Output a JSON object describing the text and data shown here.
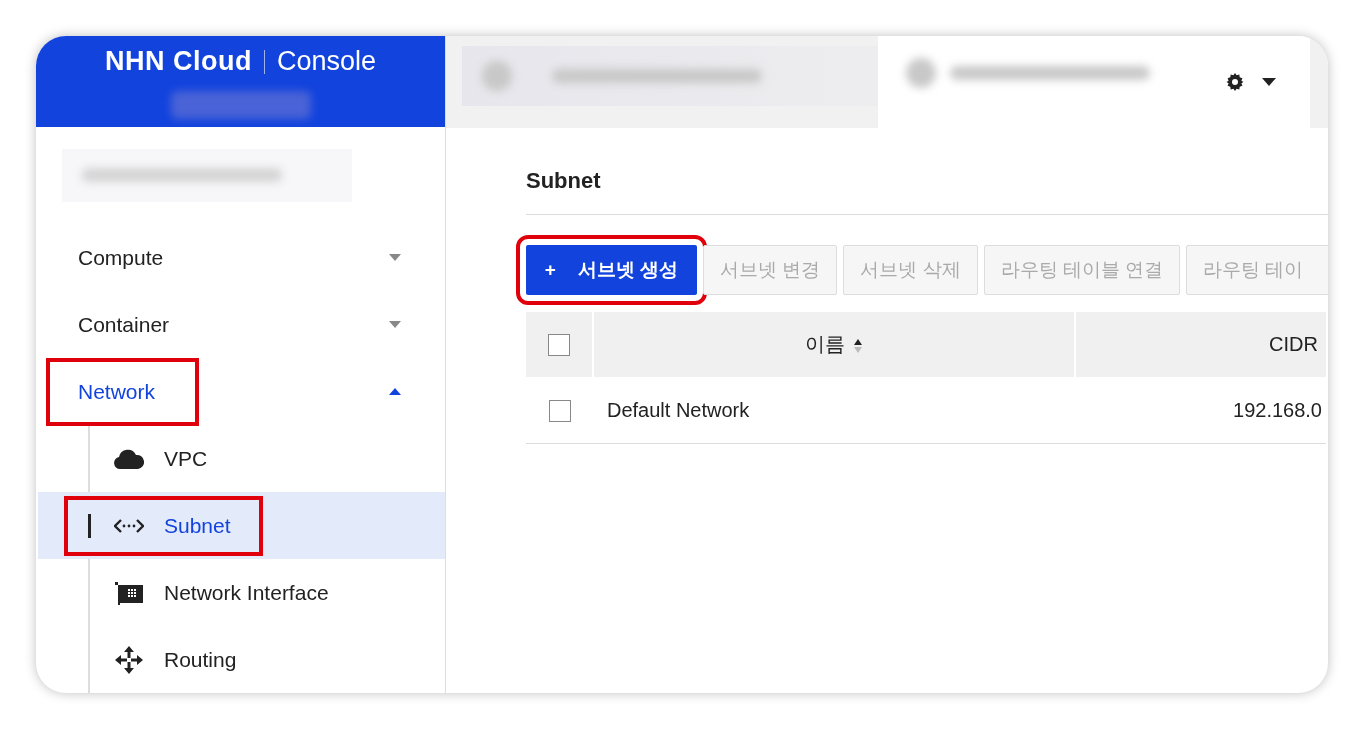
{
  "header": {
    "logo": "NHN Cloud",
    "product": "Console"
  },
  "sidebar": {
    "items": [
      {
        "label": "Compute",
        "expanded": false,
        "selected": false,
        "highlighted": false
      },
      {
        "label": "Container",
        "expanded": false,
        "selected": false,
        "highlighted": false
      },
      {
        "label": "Network",
        "expanded": true,
        "selected": true,
        "highlighted": true,
        "children": [
          {
            "label": "VPC",
            "selected": false,
            "highlighted": false
          },
          {
            "label": "Subnet",
            "selected": true,
            "highlighted": true
          },
          {
            "label": "Network Interface",
            "selected": false,
            "highlighted": false
          },
          {
            "label": "Routing",
            "selected": false,
            "highlighted": false
          }
        ]
      }
    ]
  },
  "page": {
    "title": "Subnet",
    "toolbar": [
      {
        "label": "서브넷 생성",
        "kind": "primary",
        "icon": "+",
        "disabled": false,
        "highlighted": true
      },
      {
        "label": "서브넷 변경",
        "kind": "secondary",
        "disabled": true,
        "highlighted": false
      },
      {
        "label": "서브넷 삭제",
        "kind": "secondary",
        "disabled": true,
        "highlighted": false
      },
      {
        "label": "라우팅 테이블 연결",
        "kind": "secondary",
        "disabled": true,
        "highlighted": false
      },
      {
        "label": "라우팅 테이",
        "kind": "secondary",
        "disabled": true,
        "highlighted": false
      }
    ],
    "table": {
      "columns": [
        {
          "label": "이름",
          "sortable": true
        },
        {
          "label": "CIDR",
          "sortable": false
        }
      ],
      "select_all": {
        "checked": false
      },
      "rows": [
        {
          "checked": false,
          "cells": [
            "Default Network",
            "192.168.0"
          ]
        }
      ]
    }
  }
}
